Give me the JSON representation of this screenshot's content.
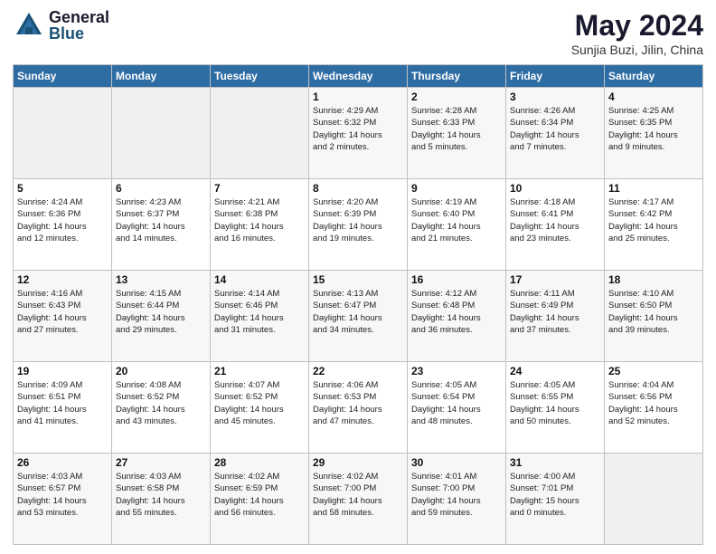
{
  "logo": {
    "general": "General",
    "blue": "Blue"
  },
  "title": "May 2024",
  "location": "Sunjia Buzi, Jilin, China",
  "headers": [
    "Sunday",
    "Monday",
    "Tuesday",
    "Wednesday",
    "Thursday",
    "Friday",
    "Saturday"
  ],
  "weeks": [
    [
      {
        "day": "",
        "info": ""
      },
      {
        "day": "",
        "info": ""
      },
      {
        "day": "",
        "info": ""
      },
      {
        "day": "1",
        "info": "Sunrise: 4:29 AM\nSunset: 6:32 PM\nDaylight: 14 hours\nand 2 minutes."
      },
      {
        "day": "2",
        "info": "Sunrise: 4:28 AM\nSunset: 6:33 PM\nDaylight: 14 hours\nand 5 minutes."
      },
      {
        "day": "3",
        "info": "Sunrise: 4:26 AM\nSunset: 6:34 PM\nDaylight: 14 hours\nand 7 minutes."
      },
      {
        "day": "4",
        "info": "Sunrise: 4:25 AM\nSunset: 6:35 PM\nDaylight: 14 hours\nand 9 minutes."
      }
    ],
    [
      {
        "day": "5",
        "info": "Sunrise: 4:24 AM\nSunset: 6:36 PM\nDaylight: 14 hours\nand 12 minutes."
      },
      {
        "day": "6",
        "info": "Sunrise: 4:23 AM\nSunset: 6:37 PM\nDaylight: 14 hours\nand 14 minutes."
      },
      {
        "day": "7",
        "info": "Sunrise: 4:21 AM\nSunset: 6:38 PM\nDaylight: 14 hours\nand 16 minutes."
      },
      {
        "day": "8",
        "info": "Sunrise: 4:20 AM\nSunset: 6:39 PM\nDaylight: 14 hours\nand 19 minutes."
      },
      {
        "day": "9",
        "info": "Sunrise: 4:19 AM\nSunset: 6:40 PM\nDaylight: 14 hours\nand 21 minutes."
      },
      {
        "day": "10",
        "info": "Sunrise: 4:18 AM\nSunset: 6:41 PM\nDaylight: 14 hours\nand 23 minutes."
      },
      {
        "day": "11",
        "info": "Sunrise: 4:17 AM\nSunset: 6:42 PM\nDaylight: 14 hours\nand 25 minutes."
      }
    ],
    [
      {
        "day": "12",
        "info": "Sunrise: 4:16 AM\nSunset: 6:43 PM\nDaylight: 14 hours\nand 27 minutes."
      },
      {
        "day": "13",
        "info": "Sunrise: 4:15 AM\nSunset: 6:44 PM\nDaylight: 14 hours\nand 29 minutes."
      },
      {
        "day": "14",
        "info": "Sunrise: 4:14 AM\nSunset: 6:46 PM\nDaylight: 14 hours\nand 31 minutes."
      },
      {
        "day": "15",
        "info": "Sunrise: 4:13 AM\nSunset: 6:47 PM\nDaylight: 14 hours\nand 34 minutes."
      },
      {
        "day": "16",
        "info": "Sunrise: 4:12 AM\nSunset: 6:48 PM\nDaylight: 14 hours\nand 36 minutes."
      },
      {
        "day": "17",
        "info": "Sunrise: 4:11 AM\nSunset: 6:49 PM\nDaylight: 14 hours\nand 37 minutes."
      },
      {
        "day": "18",
        "info": "Sunrise: 4:10 AM\nSunset: 6:50 PM\nDaylight: 14 hours\nand 39 minutes."
      }
    ],
    [
      {
        "day": "19",
        "info": "Sunrise: 4:09 AM\nSunset: 6:51 PM\nDaylight: 14 hours\nand 41 minutes."
      },
      {
        "day": "20",
        "info": "Sunrise: 4:08 AM\nSunset: 6:52 PM\nDaylight: 14 hours\nand 43 minutes."
      },
      {
        "day": "21",
        "info": "Sunrise: 4:07 AM\nSunset: 6:52 PM\nDaylight: 14 hours\nand 45 minutes."
      },
      {
        "day": "22",
        "info": "Sunrise: 4:06 AM\nSunset: 6:53 PM\nDaylight: 14 hours\nand 47 minutes."
      },
      {
        "day": "23",
        "info": "Sunrise: 4:05 AM\nSunset: 6:54 PM\nDaylight: 14 hours\nand 48 minutes."
      },
      {
        "day": "24",
        "info": "Sunrise: 4:05 AM\nSunset: 6:55 PM\nDaylight: 14 hours\nand 50 minutes."
      },
      {
        "day": "25",
        "info": "Sunrise: 4:04 AM\nSunset: 6:56 PM\nDaylight: 14 hours\nand 52 minutes."
      }
    ],
    [
      {
        "day": "26",
        "info": "Sunrise: 4:03 AM\nSunset: 6:57 PM\nDaylight: 14 hours\nand 53 minutes."
      },
      {
        "day": "27",
        "info": "Sunrise: 4:03 AM\nSunset: 6:58 PM\nDaylight: 14 hours\nand 55 minutes."
      },
      {
        "day": "28",
        "info": "Sunrise: 4:02 AM\nSunset: 6:59 PM\nDaylight: 14 hours\nand 56 minutes."
      },
      {
        "day": "29",
        "info": "Sunrise: 4:02 AM\nSunset: 7:00 PM\nDaylight: 14 hours\nand 58 minutes."
      },
      {
        "day": "30",
        "info": "Sunrise: 4:01 AM\nSunset: 7:00 PM\nDaylight: 14 hours\nand 59 minutes."
      },
      {
        "day": "31",
        "info": "Sunrise: 4:00 AM\nSunset: 7:01 PM\nDaylight: 15 hours\nand 0 minutes."
      },
      {
        "day": "",
        "info": ""
      }
    ]
  ]
}
